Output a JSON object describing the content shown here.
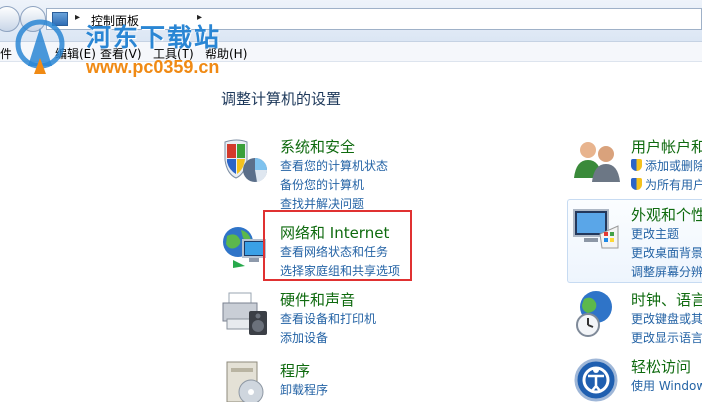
{
  "toolbar": {
    "address_text": "控制面板",
    "arrow": "▸"
  },
  "menu": {
    "file_partial": "件",
    "edit": "编辑(E)",
    "view": "查看(V)",
    "tools": "工具(T)",
    "help": "帮助(H)"
  },
  "watermark": {
    "title": "河东下载站",
    "url": "www.pc0359.cn"
  },
  "page": {
    "title": "调整计算机的设置"
  },
  "left_categories": [
    {
      "title": "系统和安全",
      "links": [
        "查看您的计算机状态",
        "备份您的计算机",
        "查找并解决问题"
      ]
    },
    {
      "title": "网络和 Internet",
      "links": [
        "查看网络状态和任务",
        "选择家庭组和共享选项"
      ]
    },
    {
      "title": "硬件和声音",
      "links": [
        "查看设备和打印机",
        "添加设备"
      ]
    },
    {
      "title": "程序",
      "links": [
        "卸载程序"
      ]
    }
  ],
  "right_categories": [
    {
      "title": "用户帐户和",
      "links": [
        "添加或删除",
        "为所有用户"
      ]
    },
    {
      "title": "外观和个性",
      "links": [
        "更改主题",
        "更改桌面背景",
        "调整屏幕分辨"
      ]
    },
    {
      "title": "时钟、语言",
      "links": [
        "更改键盘或其",
        "更改显示语言"
      ]
    },
    {
      "title": "轻松访问",
      "links": [
        "使用 Window"
      ]
    }
  ],
  "colors": {
    "category_title": "#0e6a0e",
    "link": "#2463a5",
    "highlight_box": "#e03131",
    "watermark_blue": "#2a86d4",
    "watermark_orange": "#f08a14"
  },
  "icons": {
    "security": "shield-pie-icon",
    "network": "globe-monitor-icon",
    "hardware": "printer-speaker-icon",
    "programs": "program-box-icon",
    "users": "users-icon",
    "appearance": "monitor-palette-icon",
    "clock": "globe-clock-icon",
    "access": "ease-of-access-icon"
  }
}
